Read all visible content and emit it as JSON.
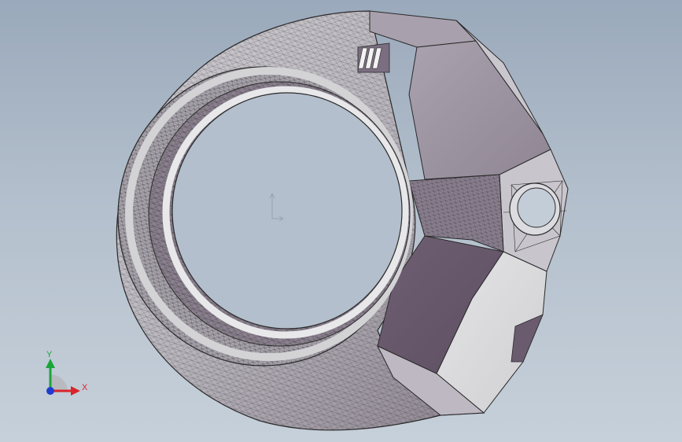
{
  "viewport": {
    "background_top": "#9aa9bb",
    "background_bottom": "#c6d0da"
  },
  "model": {
    "shading_light": "#d9d9dd",
    "shading_mid": "#a39aa6",
    "shading_dark": "#6a5c6e",
    "edge_color": "#2a2a2a"
  },
  "triad": {
    "x_label": "X",
    "y_label": "Y",
    "x_color": "#d8242a",
    "y_color": "#1aa53a",
    "z_color": "#1f3ccf"
  },
  "origin_marker": {
    "icon": "origin-icon"
  }
}
